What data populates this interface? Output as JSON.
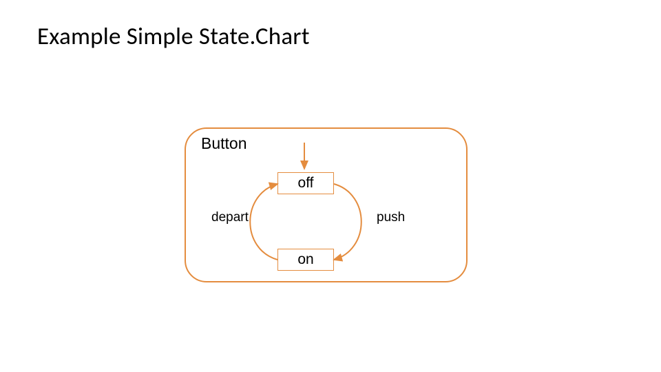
{
  "title": "Example Simple State.Chart",
  "colors": {
    "stroke": "#e48c3e",
    "text": "#000000",
    "background": "#ffffff"
  },
  "diagram": {
    "container_label": "Button",
    "states": {
      "off": "off",
      "on": "on"
    },
    "transitions": {
      "depart": "depart",
      "push": "push"
    }
  },
  "chart_data": {
    "type": "statechart",
    "name": "Button",
    "initial_state": "off",
    "states": [
      "off",
      "on"
    ],
    "transitions": [
      {
        "from": "off",
        "to": "on",
        "event": "push"
      },
      {
        "from": "on",
        "to": "off",
        "event": "depart"
      }
    ]
  }
}
